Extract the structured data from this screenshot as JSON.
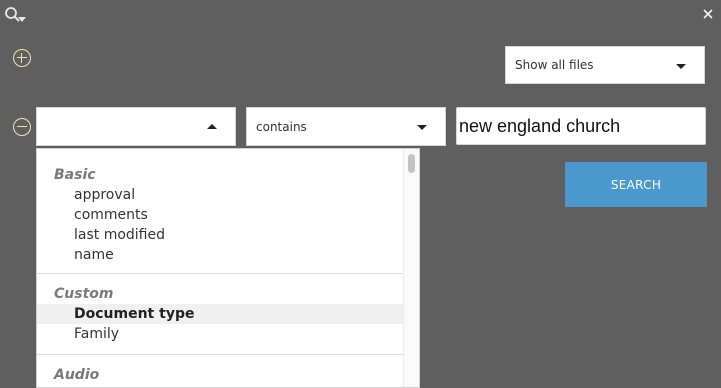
{
  "toolbar": {
    "search_toggle_icon": "search-filter-icon",
    "close_icon": "close-icon",
    "add_icon": "plus-circle-icon",
    "remove_icon": "minus-circle-icon"
  },
  "scope": {
    "selected": "Show all files"
  },
  "criteria": {
    "field_selected": "",
    "operator_selected": "contains",
    "query_value": "new england church"
  },
  "search_button": {
    "label": "SEARCH"
  },
  "colors": {
    "background": "#5f5f5f",
    "accent": "#4a98cd",
    "icon_yellow": "#ece5b2"
  },
  "field_dropdown": {
    "groups": [
      {
        "label": "Basic",
        "options": [
          "approval",
          "comments",
          "last modified",
          "name"
        ]
      },
      {
        "label": "Custom",
        "options": [
          "Document type",
          "Family"
        ],
        "highlighted": "Document type"
      },
      {
        "label": "Audio",
        "options": []
      }
    ]
  }
}
